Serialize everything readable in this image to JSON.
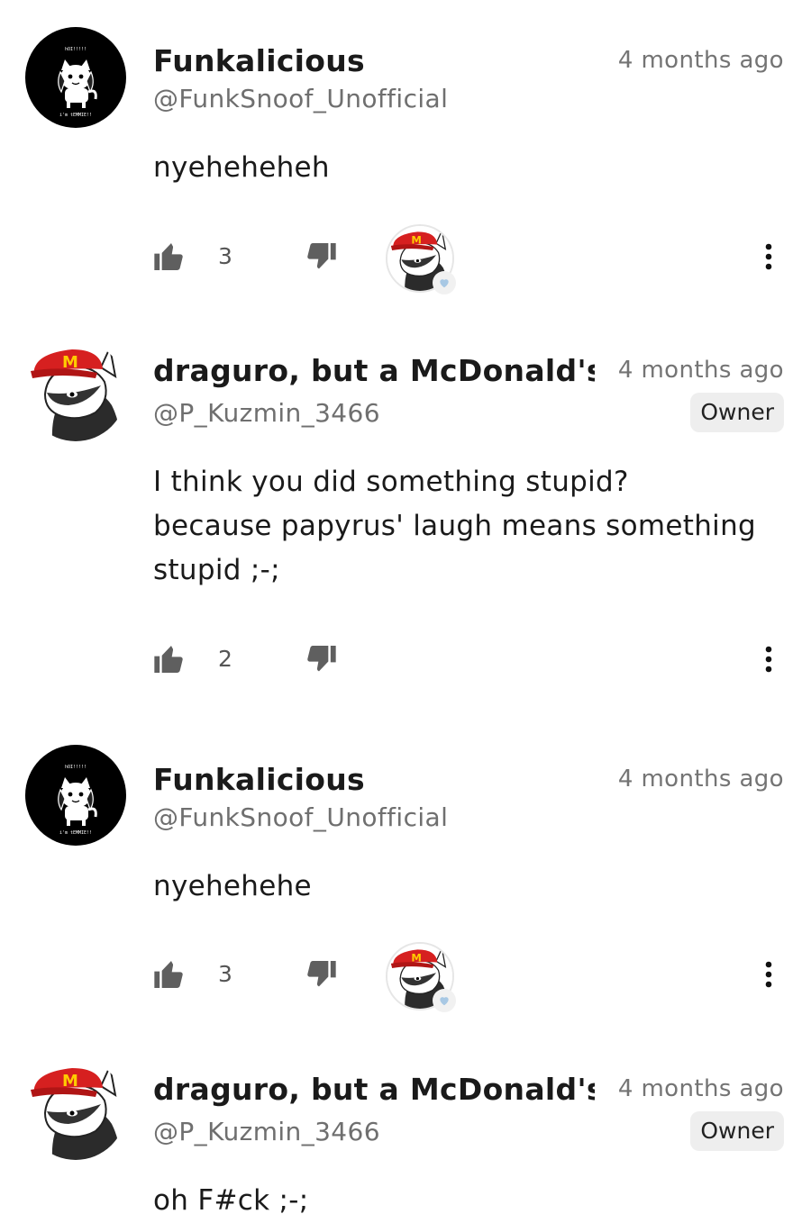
{
  "comments": [
    {
      "author": "Funkalicious",
      "handle": "@FunkSnoof_Unofficial",
      "time": "4 months ago",
      "avatar_icon": "temmie-avatar",
      "lines": [
        "nyeheheheh"
      ],
      "likes": "3",
      "hearted_by_owner": true
    },
    {
      "author": "draguro, but a McDonald's employee",
      "handle": "@P_Kuzmin_3466",
      "time": "4 months ago",
      "badge": "Owner",
      "avatar_icon": "draguro-avatar",
      "lines": [
        "I think you did something stupid?",
        "because papyrus' laugh means something",
        "stupid ;-;"
      ],
      "likes": "2",
      "hearted_by_owner": false
    },
    {
      "author": "Funkalicious",
      "handle": "@FunkSnoof_Unofficial",
      "time": "4 months ago",
      "avatar_icon": "temmie-avatar",
      "lines": [
        "nyehehehe"
      ],
      "likes": "3",
      "hearted_by_owner": true
    },
    {
      "author": "draguro, but a McDonald's employee",
      "handle": "@P_Kuzmin_3466",
      "time": "4 months ago",
      "badge": "Owner",
      "avatar_icon": "draguro-avatar",
      "lines": [
        "oh F#ck ;-;"
      ]
    }
  ],
  "colors": {
    "text": "#1a1a1a",
    "secondary": "#6f6f6f",
    "icon": "#5f5f5f",
    "heart": "#a8c8e4",
    "cap_red": "#d62020"
  }
}
